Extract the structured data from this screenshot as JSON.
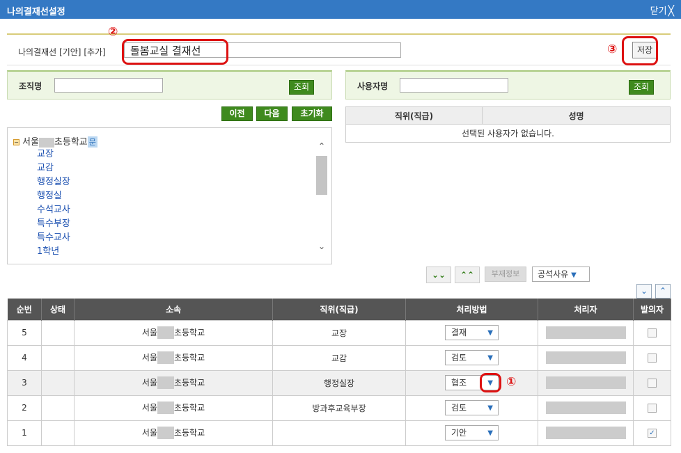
{
  "window": {
    "title": "나의결재선설정",
    "close_label": "닫기",
    "close_glyph": "╳"
  },
  "annotations": {
    "n1": "①",
    "n2": "②",
    "n3": "③"
  },
  "line_name": {
    "label": "나의결재선",
    "tag_draft": "[기안]",
    "tag_add": "[추가]",
    "value": "돌봄교실 결재선",
    "save_label": "저장"
  },
  "org_search": {
    "label": "조직명",
    "value": "",
    "button": "조회"
  },
  "user_search": {
    "label": "사용자명",
    "value": "",
    "button": "조회"
  },
  "org_nav": {
    "prev": "이전",
    "next": "다음",
    "reset": "초기화"
  },
  "org_tree": {
    "root_prefix": "서울",
    "root_suffix": "초등학교",
    "root_badge": "문",
    "items": [
      "교장",
      "교감",
      "행정실장",
      "행정실",
      "수석교사",
      "특수부장",
      "특수교사",
      "1학년"
    ]
  },
  "user_table": {
    "col_position": "직위(직급)",
    "col_name": "성명",
    "empty_message": "선택된 사용자가 없습니다."
  },
  "controls": {
    "down_glyph": "⌄⌄",
    "up_glyph": "⌃⌃",
    "absence_info": "부재정보",
    "absence_reason": "공석사유",
    "collapse_glyph": "⌄",
    "expand_glyph": "⌃"
  },
  "line_table": {
    "headers": {
      "seq": "순번",
      "status": "상태",
      "dept": "소속",
      "position": "직위(직급)",
      "method": "처리방법",
      "handler": "처리자",
      "initiator": "발의자"
    },
    "rows": [
      {
        "seq": "5",
        "dept_prefix": "서울",
        "dept_suffix": "초등학교",
        "position": "교장",
        "method": "결재",
        "initiator": false
      },
      {
        "seq": "4",
        "dept_prefix": "서울",
        "dept_suffix": "초등학교",
        "position": "교감",
        "method": "검토",
        "initiator": false
      },
      {
        "seq": "3",
        "dept_prefix": "서울",
        "dept_suffix": "초등학교",
        "position": "행정실장",
        "method": "협조",
        "initiator": false
      },
      {
        "seq": "2",
        "dept_prefix": "서울",
        "dept_suffix": "초등학교",
        "position": "방과후교육부장",
        "method": "검토",
        "initiator": false
      },
      {
        "seq": "1",
        "dept_prefix": "서울",
        "dept_suffix": "초등학교",
        "position": "",
        "method": "기안",
        "initiator": true
      }
    ]
  },
  "colors": {
    "titlebar": "#3479c4",
    "green_button": "#3f8a1e",
    "annotation_red": "#dd1111",
    "table_header": "#555555"
  }
}
